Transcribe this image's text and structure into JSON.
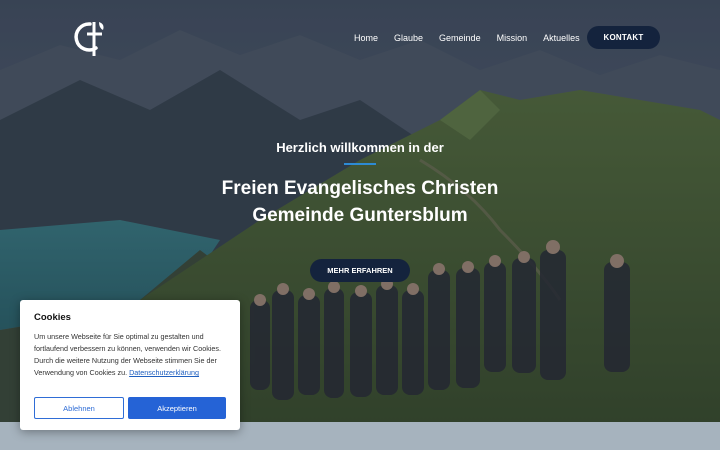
{
  "nav": {
    "items": [
      "Home",
      "Glaube",
      "Gemeinde",
      "Mission",
      "Aktuelles"
    ],
    "contact_label": "KONTAKT"
  },
  "hero": {
    "welcome": "Herzlich willkommen in der",
    "title_line1": "Freien Evangelisches Christen",
    "title_line2": "Gemeinde Guntersblum",
    "cta_label": "MEHR ERFAHREN"
  },
  "cookie": {
    "title": "Cookies",
    "text": "Um unsere Webseite für Sie optimal zu gestalten und fortlaufend verbessern zu können, verwenden wir Cookies. Durch die weitere Nutzung der Webseite stimmen Sie der Verwendung von Cookies zu.",
    "link": "Datenschutzerklärung",
    "decline": "Ablehnen",
    "accept": "Akzeptieren"
  },
  "colors": {
    "button_bg": "#14233d",
    "accent": "#2563d6",
    "divider": "#2d8bd4",
    "footer_strip": "#a6b3be"
  },
  "icons": [
    "church-logo-icon"
  ]
}
